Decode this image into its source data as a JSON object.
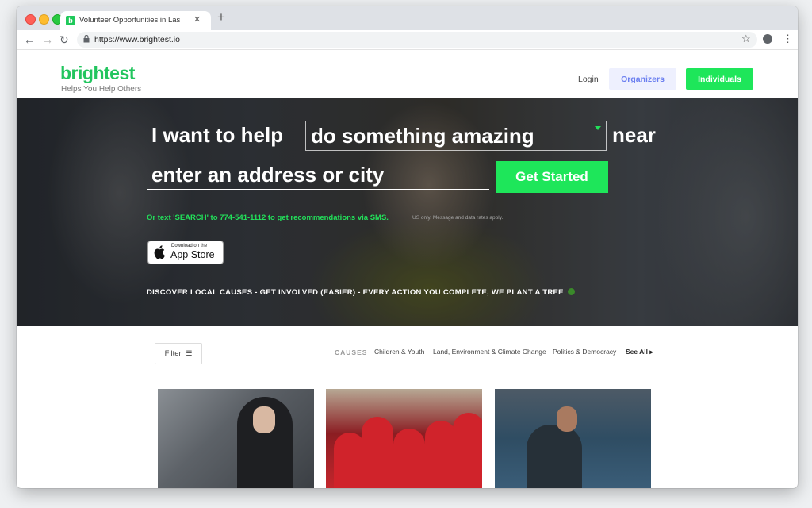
{
  "browser": {
    "tab_title": "Volunteer Opportunities in Las",
    "tab_favicon": "b",
    "url": "https://www.brightest.io",
    "icons": [
      "back-icon",
      "forward-icon",
      "reload-icon",
      "lock-icon",
      "star-icon",
      "profile-icon",
      "menu-icon"
    ]
  },
  "header": {
    "logo": "brightest",
    "tagline": "Helps You Help Others",
    "login": "Login",
    "organizers": "Organizers",
    "individuals": "Individuals",
    "accent_color": "#1ee65a"
  },
  "hero": {
    "prefix": "I want to help",
    "cause_value": "do something amazing",
    "near": "near",
    "address_placeholder": "enter an address or city",
    "get_started": "Get Started",
    "sms_text": "Or text 'SEARCH' to 774-541-1112 to get recommendations via SMS.",
    "sms_fine": "US only. Message and data rates apply.",
    "appstore_small": "Download on the",
    "appstore_big": "App Store",
    "discover": "DISCOVER LOCAL CAUSES  -  GET INVOLVED (EASIER)  -  EVERY ACTION YOU COMPLETE, WE PLANT A TREE"
  },
  "filters": {
    "filter_label": "Filter",
    "causes_label": "CAUSES",
    "causes": [
      "Children & Youth",
      "Land, Environment & Climate Change",
      "Politics & Democracy"
    ],
    "see_all": "See All"
  }
}
